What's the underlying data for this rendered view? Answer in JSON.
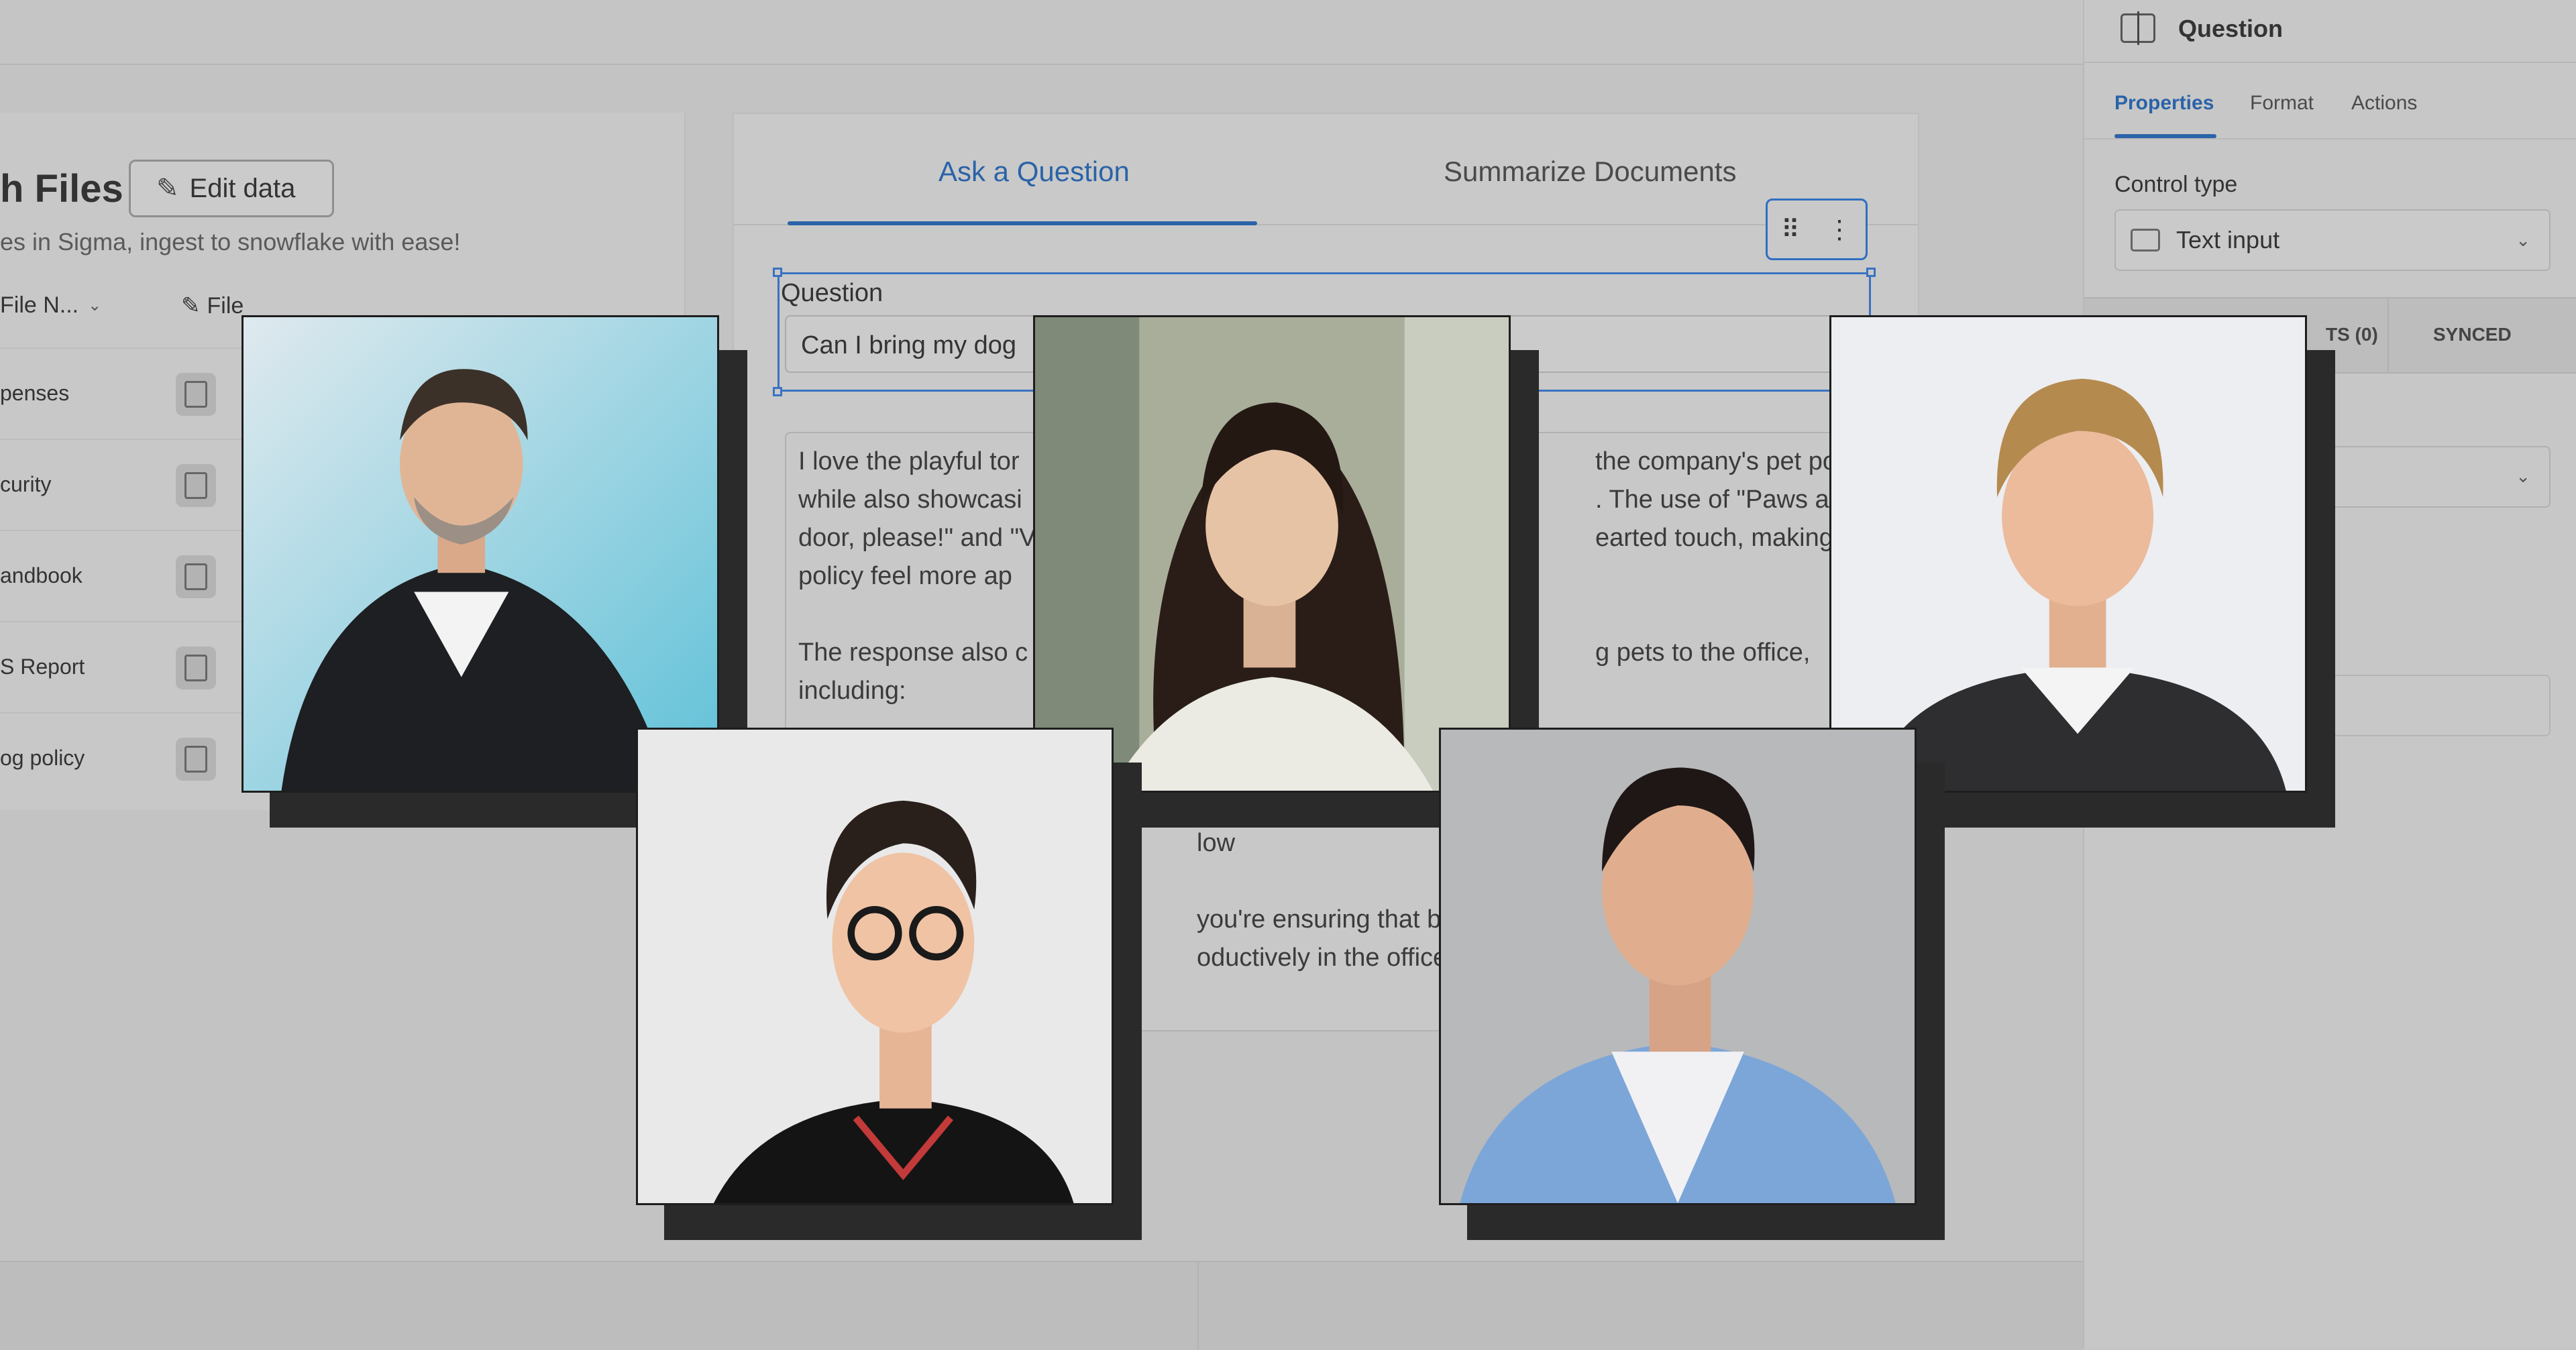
{
  "left_panel": {
    "title_fragment": "h Files",
    "edit_button": "Edit data",
    "subtitle_fragment": "es in Sigma, ingest to snowflake with ease!",
    "col_headers": [
      "File N...",
      "File"
    ],
    "rows": [
      "penses",
      "curity",
      "andbook",
      "S Report",
      "og policy"
    ]
  },
  "center": {
    "tabs": {
      "ask": "Ask a Question",
      "summarize": "Summarize Documents"
    },
    "toolbar": {
      "drag": "⠿",
      "more": "⋮"
    },
    "question_label": "Question",
    "question_value": "Can I bring my dog",
    "response_lines": {
      "l1a": "I love the playful tor",
      "l1b": "the company's pet polic",
      "l2a": "while also showcasi",
      "l2b": ". The use of \"Paws at the",
      "l3a": "door, please!\" and \"V",
      "l3b": "earted touch, making the",
      "l4": "policy feel more ap",
      "l5a": "The response also c",
      "l5b": "g pets to the office,",
      "l6": "including:",
      "l7": "low",
      "l8": "you're ensuring that bot",
      "l9": "oductively in the office."
    }
  },
  "right_panel": {
    "title": "Question",
    "tabs": [
      "Properties",
      "Format",
      "Actions"
    ],
    "control_type_label": "Control type",
    "control_type_value": "Text input",
    "strip_left": "TS (0)",
    "strip_right": "SYNCED"
  },
  "icons": {
    "edit": "pencil-icon",
    "pdf": "pdf-file-icon",
    "chevron": "chevron-down-icon",
    "drag": "drag-handle-icon",
    "more": "more-vertical-icon",
    "control": "text-input-icon"
  },
  "colors": {
    "accent": "#2a63a8",
    "background": "#c3c3c3",
    "photo_shadow": "#2a2a2a"
  }
}
